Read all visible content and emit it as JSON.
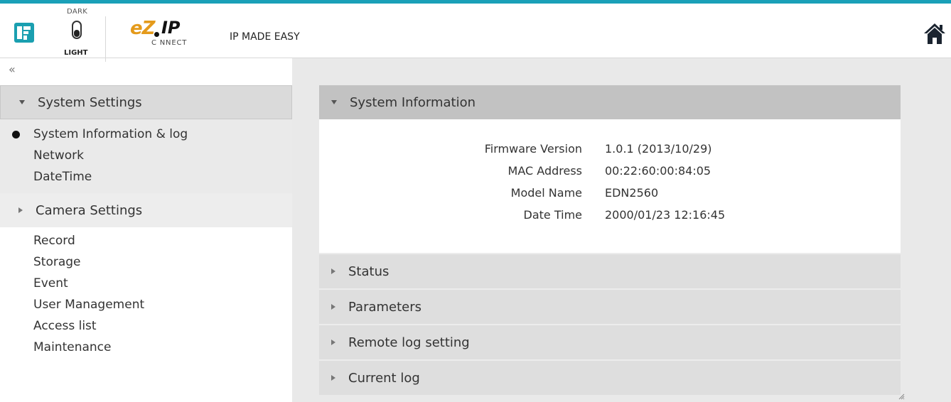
{
  "header": {
    "theme_dark_label": "DARK",
    "theme_light_label": "LIGHT",
    "brand_ez": "eZ",
    "brand_ip": "IP",
    "brand_connect": "C NNECT",
    "tagline": "IP MADE EASY",
    "home_icon": "home-icon",
    "logo_icon": "app-logo-icon",
    "accent_color": "#1aa0b8"
  },
  "sidebar": {
    "collapse_glyph": "«",
    "sections": [
      {
        "label": "System Settings",
        "expanded": true,
        "items": [
          "System Information & log",
          "Network",
          "DateTime"
        ],
        "selected_item": "System Information & log"
      },
      {
        "label": "Camera Settings",
        "expanded": false,
        "items": [
          "Record",
          "Storage",
          "Event",
          "User Management",
          "Access list",
          "Maintenance"
        ]
      }
    ]
  },
  "main": {
    "panels": [
      {
        "title": "System Information",
        "open": true,
        "rows": [
          {
            "label": "Firmware Version",
            "value": "1.0.1 (2013/10/29)"
          },
          {
            "label": "MAC Address",
            "value": "00:22:60:00:84:05"
          },
          {
            "label": "Model Name",
            "value": "EDN2560"
          },
          {
            "label": "Date Time",
            "value": "2000/01/23 12:16:45"
          }
        ]
      },
      {
        "title": "Status",
        "open": false
      },
      {
        "title": "Parameters",
        "open": false
      },
      {
        "title": "Remote log setting",
        "open": false
      },
      {
        "title": "Current log",
        "open": false
      }
    ]
  }
}
